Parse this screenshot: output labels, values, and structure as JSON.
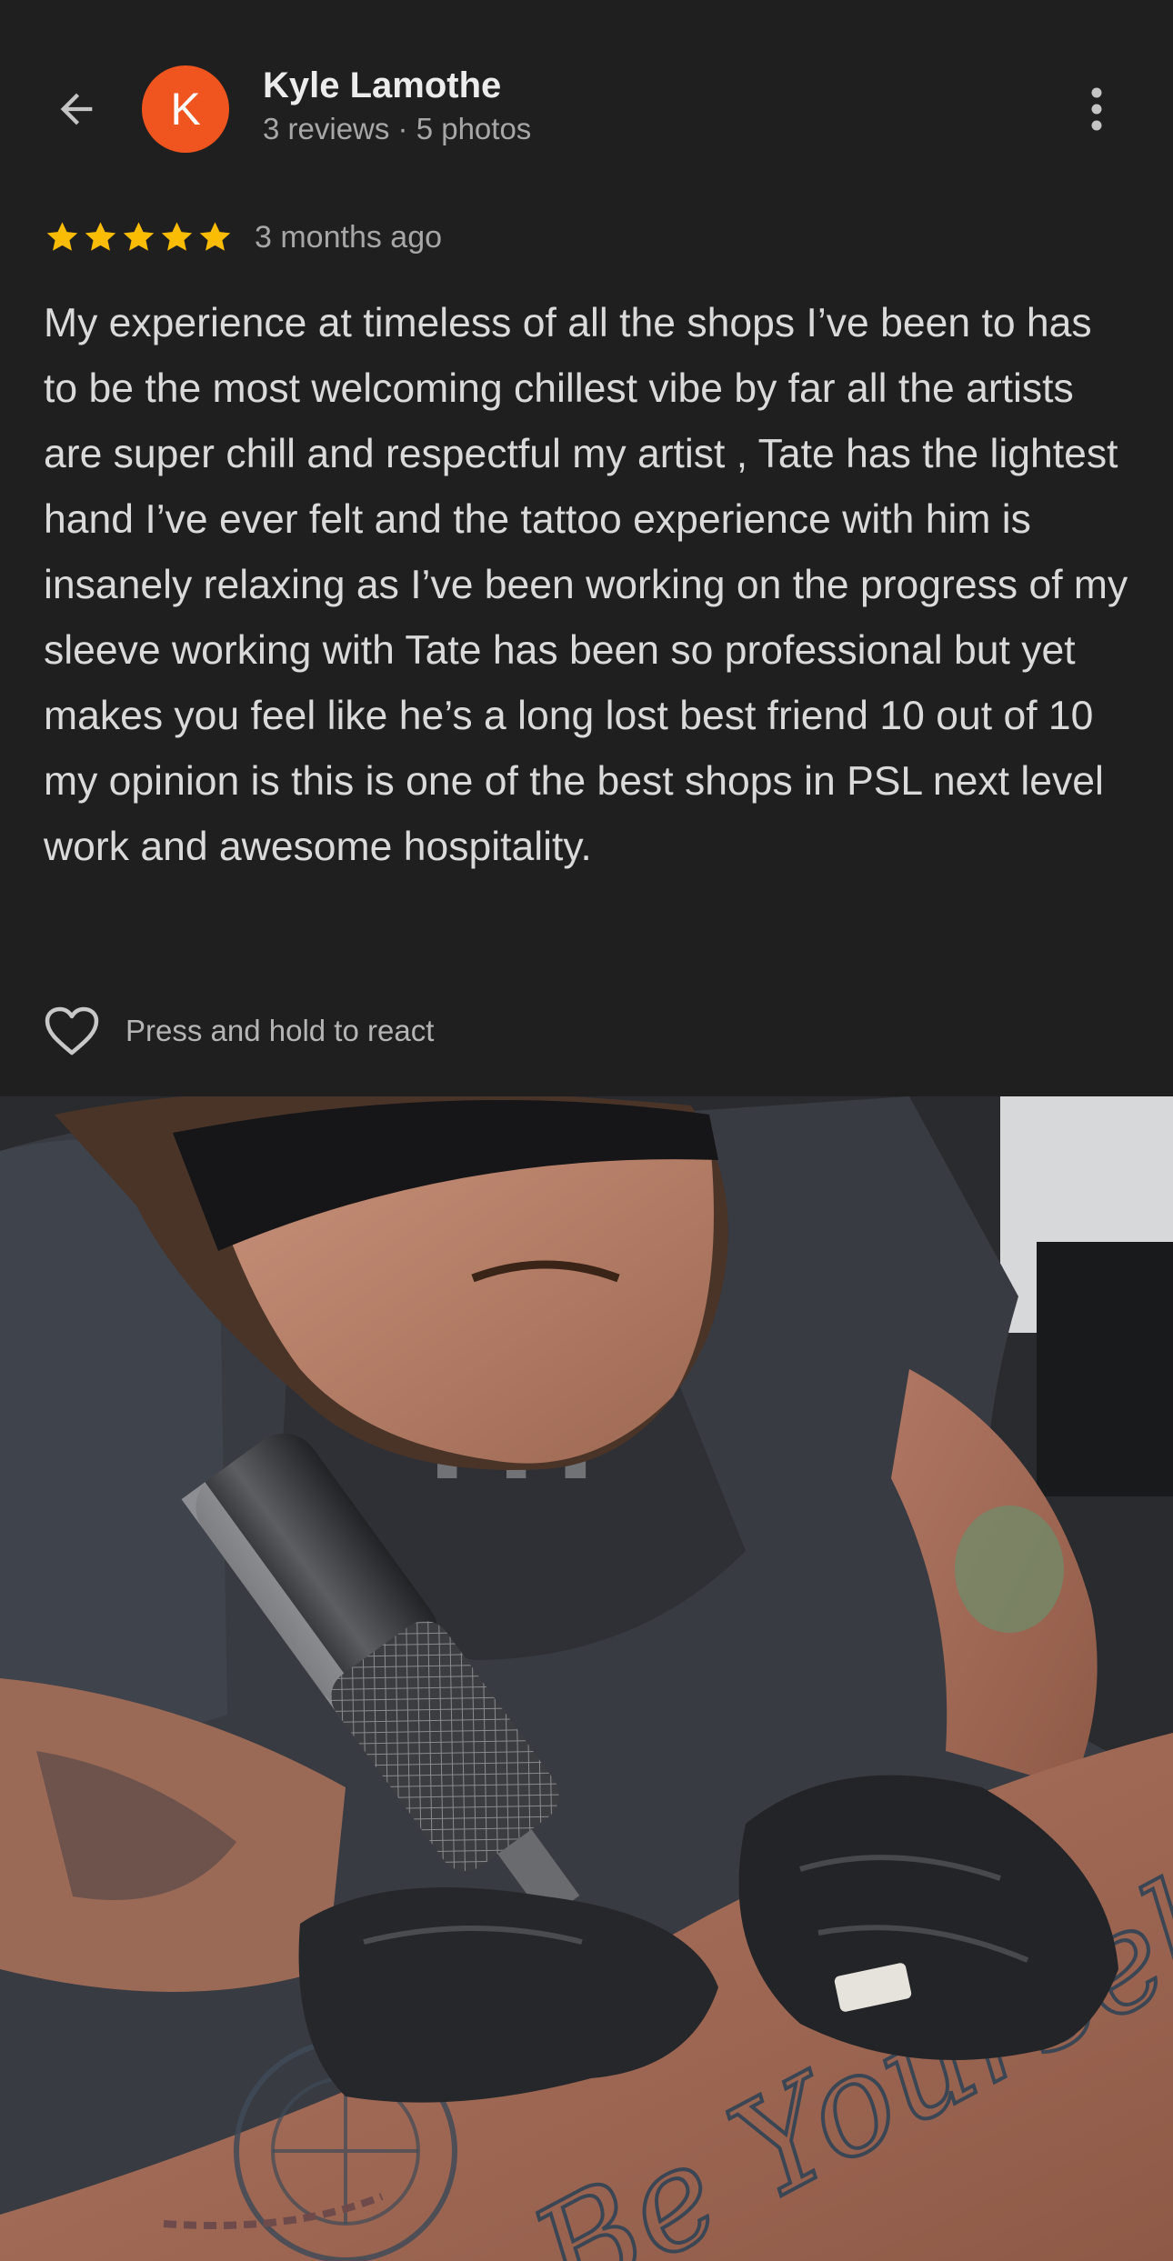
{
  "header": {
    "back_icon": "arrow-left-icon",
    "avatar_letter": "K",
    "avatar_color": "#f0541f",
    "reviewer_name": "Kyle Lamothe",
    "reviewer_meta": "3 reviews · 5 photos",
    "more_icon": "more-vert-icon"
  },
  "review": {
    "rating": 5,
    "max_rating": 5,
    "star_color": "#fbbc04",
    "age": "3 months ago",
    "text": "My experience at timeless of all the shops I’ve been to has to be the most welcoming chillest vibe by far all the artists are super chill and respectful my artist , Tate has the lightest hand I’ve ever felt and the tattoo experience with him is insanely relaxing as I’ve been working on the progress of my sleeve working with Tate has been so professional but yet makes you feel like he’s a long lost best friend 10 out of 10 my opinion is this is one of the best shops in PSL next level work and awesome hospitality."
  },
  "reaction": {
    "icon": "heart-outline-icon",
    "label": "Press and hold to react"
  },
  "photo": {
    "tattoo_script": "Be Yourself"
  }
}
